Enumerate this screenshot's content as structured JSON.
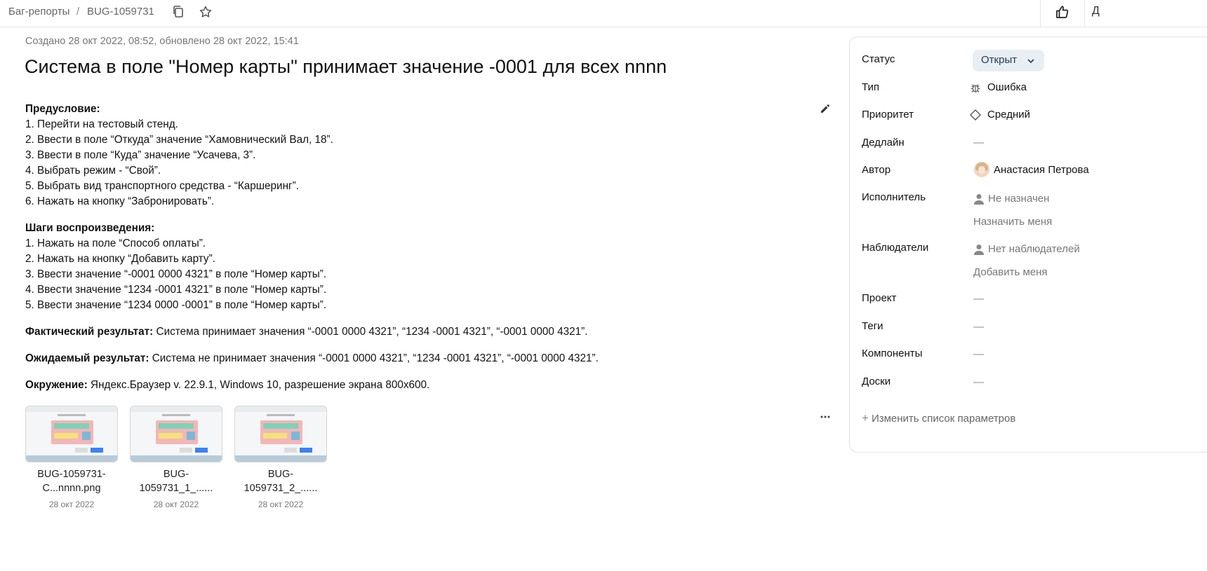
{
  "breadcrumb": {
    "parent": "Баг-репорты",
    "separator": "/",
    "key": "BUG-1059731"
  },
  "topbar": {
    "copy_icon": "copy-icon",
    "star_icon": "star-icon",
    "like_icon": "thumb-up-icon",
    "cut_label": "Д"
  },
  "issue": {
    "meta": "Создано 28 окт 2022, 08:52, обновлено 28 окт 2022, 15:41",
    "title": "Система в поле \"Номер карты\" принимает значение -0001 для всех nnnn"
  },
  "description": {
    "precondition_title": "Предусловие:",
    "precondition_steps": [
      "1. Перейти на тестовый стенд.",
      "2. Ввести в поле “Откуда” значение “Хамовнический Вал, 18”.",
      "3. Ввести в поле “Куда” значение “Усачева, 3”.",
      "4. Выбрать режим - “Свой”.",
      "5. Выбрать вид транспортного средства - “Каршеринг”.",
      "6. Нажать на кнопку “Забронировать”."
    ],
    "steps_title": "Шаги воспроизведения:",
    "steps": [
      "1. Нажать на поле “Способ оплаты”.",
      "2. Нажать на кнопку “Добавить карту”.",
      "3. Ввести значение “-0001 0000 4321” в поле “Номер карты”.",
      "4. Ввести значение “1234 -0001 4321” в поле “Номер карты”.",
      "5. Ввести значение “1234 0000 -0001” в поле “Номер карты”."
    ],
    "actual_label": "Фактический результат:",
    "actual_text": " Система принимает значения “-0001 0000 4321”, “1234 -0001 4321”, “-0001 0000 4321”.",
    "expected_label": "Ожидаемый результат:",
    "expected_text": " Система не принимает значения “-0001 0000 4321”, “1234 -0001 4321”, “-0001 0000 4321”.",
    "env_label": "Окружение:",
    "env_text": " Яндекс.Браузер v. 22.9.1, Windows 10, разрешение экрана 800x600."
  },
  "attachments": [
    {
      "name_line1": "BUG-1059731-",
      "name_line2": "C...nnnn.png",
      "date": "28 окт 2022"
    },
    {
      "name_line1": "BUG-",
      "name_line2": "1059731_1_......",
      "date": "28 окт 2022"
    },
    {
      "name_line1": "BUG-",
      "name_line2": "1059731_2_......",
      "date": "28 окт 2022"
    }
  ],
  "fields": {
    "status_label": "Статус",
    "status_value": "Открыт",
    "type_label": "Тип",
    "type_value": "Ошибка",
    "priority_label": "Приоритет",
    "priority_value": "Средний",
    "deadline_label": "Дедлайн",
    "deadline_value": "—",
    "author_label": "Автор",
    "author_value": "Анастасия Петрова",
    "assignee_label": "Исполнитель",
    "assignee_value": "Не назначен",
    "assign_me": "Назначить меня",
    "followers_label": "Наблюдатели",
    "followers_value": "Нет наблюдателей",
    "add_me": "Добавить меня",
    "project_label": "Проект",
    "project_value": "—",
    "tags_label": "Теги",
    "tags_value": "—",
    "components_label": "Компоненты",
    "components_value": "—",
    "boards_label": "Доски",
    "boards_value": "—",
    "change_params": "Изменить список параметров"
  }
}
